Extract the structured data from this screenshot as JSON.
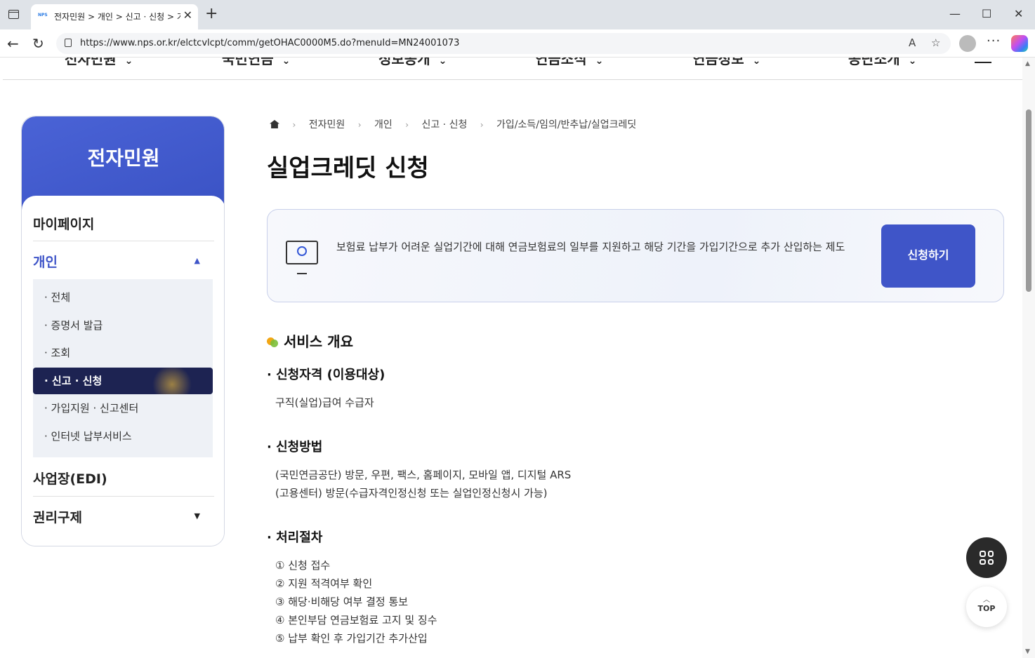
{
  "browser": {
    "tab_title": "전자민원 > 개인 > 신고 · 신청 > 가입/소득/임의/반추납/실업크레딧",
    "url": "https://www.nps.or.kr/elctcvlcpt/comm/getOHAC0000M5.do?menuId=MN24001073"
  },
  "gnb": {
    "items": [
      "전자민원",
      "국민연금",
      "정보공개",
      "연금소식",
      "연금정보",
      "공단소개"
    ]
  },
  "sidebar": {
    "title": "전자민원",
    "menus": [
      {
        "label": "마이페이지"
      },
      {
        "label": "개인"
      },
      {
        "label": "사업장(EDI)"
      },
      {
        "label": "권리구제"
      }
    ],
    "sub_items": [
      "· 전체",
      "· 증명서 발급",
      "· 조회",
      "· 신고 · 신청",
      "· 가입지원 · 신고센터",
      "· 인터넷 납부서비스"
    ],
    "active_sub": "· 신고 · 신청"
  },
  "breadcrumb": [
    "전자민원",
    "개인",
    "신고 · 신청",
    "가입/소득/임의/반추납/실업크레딧"
  ],
  "page_title": "실업크레딧 신청",
  "info_box": {
    "text": "보험료 납부가 어려운 실업기간에 대해 연금보험료의 일부를 지원하고 해당 기간을 가입기간으로 추가 산입하는 제도",
    "button": "신청하기"
  },
  "section_title": "서비스 개요",
  "eligibility": {
    "heading": "· 신청자격 (이용대상)",
    "text": "구직(실업)급여 수급자"
  },
  "method": {
    "heading": "· 신청방법",
    "lines": [
      "(국민연금공단) 방문, 우편, 팩스, 홈페이지, 모바일 앱, 디지털 ARS",
      "(고용센터) 방문(수급자격인정신청 또는 실업인정신청시 가능)"
    ]
  },
  "procedure": {
    "heading": "· 처리절차",
    "steps": [
      "① 신청 접수",
      "② 지원 적격여부 확인",
      "③ 해당·비해당 여부 결정 통보",
      "④ 본인부담 연금보험료 고지 및 징수",
      "⑤ 납부 확인 후 가입기간 추가산입"
    ]
  },
  "fab": {
    "top_label": "TOP"
  },
  "colors": {
    "primary": "#3f55c8",
    "active_menu": "#1d2352"
  }
}
